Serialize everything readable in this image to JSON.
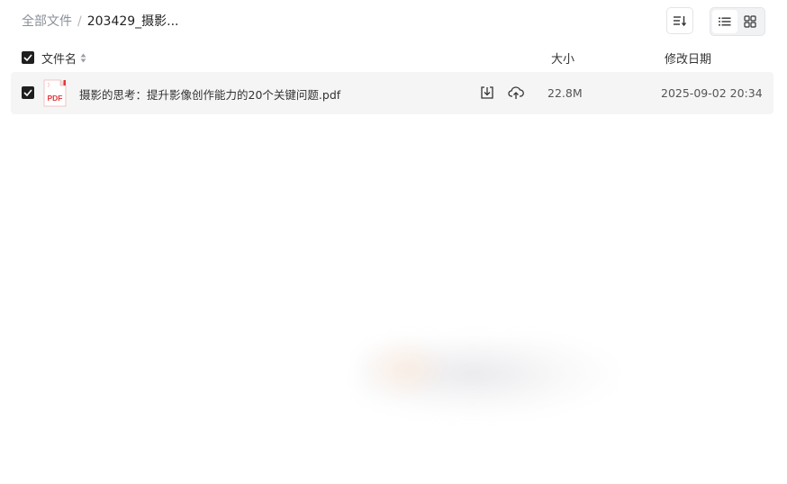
{
  "breadcrumb": {
    "root": "全部文件",
    "separator": "/",
    "current": "203429_摄影..."
  },
  "toolbar": {
    "sort_icon": "sort-lines-icon",
    "view_list_icon": "list-view-icon",
    "view_grid_icon": "grid-view-icon",
    "active_view": "list"
  },
  "table": {
    "columns": {
      "name": "文件名",
      "size": "大小",
      "date": "修改日期"
    },
    "rows": [
      {
        "selected": true,
        "icon": "pdf-file-icon",
        "icon_label": "PDF",
        "name": "摄影的思考：提升影像创作能力的20个关键问题.pdf",
        "size": "22.8M",
        "modified": "2025-09-02 20:34"
      }
    ]
  },
  "colors": {
    "checkbox": "#1f1f1f",
    "row_background": "#f5f5f6",
    "pdf_red": "#e0393e"
  }
}
